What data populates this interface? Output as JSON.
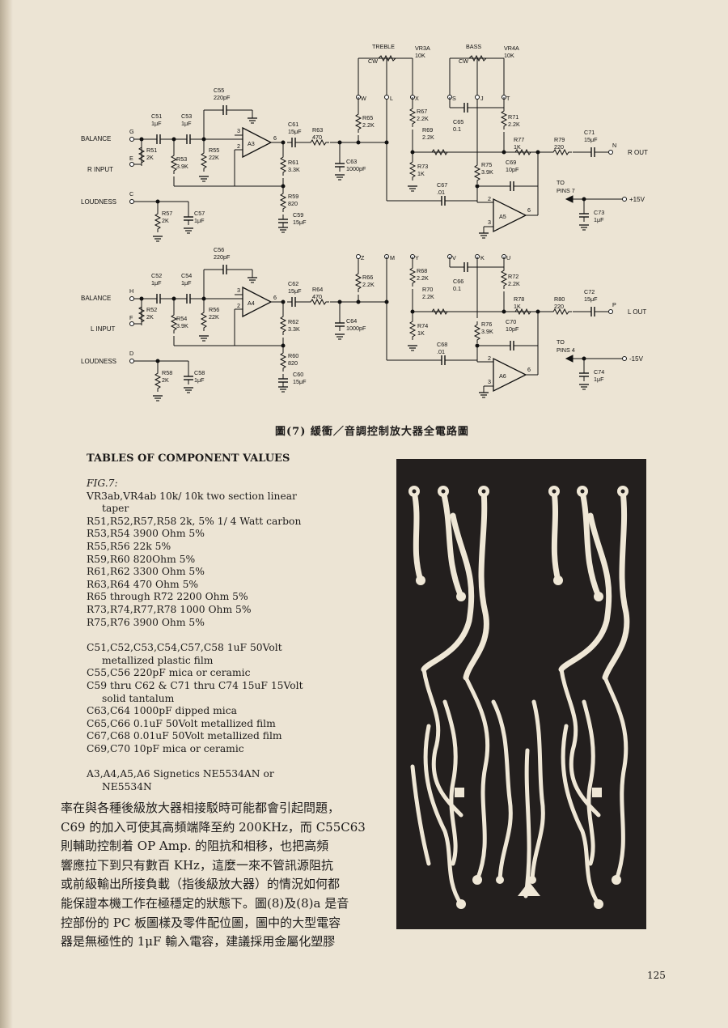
{
  "caption": "圖(7) 緩衝／音調控制放大器全電路圖",
  "table_title": "TABLES OF COMPONENT VALUES",
  "fig_label": "FIG.7:",
  "components": [
    {
      "text": "VR3ab,VR4ab  10k/ 10k two section linear",
      "indent": false
    },
    {
      "text": "taper",
      "indent": true
    },
    {
      "text": "R51,R52,R57,R58  2k, 5%  1/ 4 Watt carbon",
      "indent": false
    },
    {
      "text": "R53,R54  3900 Ohm 5%",
      "indent": false
    },
    {
      "text": "R55,R56  22k 5%",
      "indent": false
    },
    {
      "text": "R59,R60  820Ohm 5%",
      "indent": false
    },
    {
      "text": "R61,R62  3300 Ohm 5%",
      "indent": false
    },
    {
      "text": "R63,R64  470 Ohm 5%",
      "indent": false
    },
    {
      "text": "R65 through R72  2200 Ohm 5%",
      "indent": false
    },
    {
      "text": "R73,R74,R77,R78  1000 Ohm 5%",
      "indent": false
    },
    {
      "text": "R75,R76  3900 Ohm 5%",
      "indent": false
    },
    {
      "text": "",
      "gap": true
    },
    {
      "text": "C51,C52,C53,C54,C57,C58  1uF  50Volt",
      "indent": false
    },
    {
      "text": "metallized plastic film",
      "indent": true
    },
    {
      "text": "C55,C56  220pF mica or ceramic",
      "indent": false
    },
    {
      "text": "C59 thru C62 & C71 thru C74  15uF  15Volt",
      "indent": false
    },
    {
      "text": "solid tantalum",
      "indent": true
    },
    {
      "text": "C63,C64  1000pF dipped mica",
      "indent": false
    },
    {
      "text": "C65,C66  0.1uF 50Volt metallized film",
      "indent": false
    },
    {
      "text": "C67,C68  0.01uF 50Volt metallized film",
      "indent": false
    },
    {
      "text": "C69,C70  10pF mica or ceramic",
      "indent": false
    },
    {
      "text": "",
      "gap": true
    },
    {
      "text": "A3,A4,A5,A6  Signetics   NE5534AN   or",
      "indent": false
    },
    {
      "text": "NE5534N",
      "indent": true
    }
  ],
  "chinese_paragraph": [
    "率在與各種後級放大器相接駁時可能都會引起問題，",
    "C69 的加入可使其高頻端降至約 200KHz，而 C55C63",
    "則輔助控制着 OP Amp. 的阻抗和相移，也把高頻",
    "響應拉下到只有數百 KHz，這麼一來不管訊源阻抗",
    "或前級輸出所接負載（指後級放大器）的情況如何都",
    "能保證本機工作在極穩定的狀態下。圖(8)及(8)a 是音",
    "控部份的 PC 板圖樣及零件配位圖，圖中的大型電容",
    "器是無極性的 1μF 輸入電容，建議採用金屬化塑膠"
  ],
  "page_number": "125",
  "schematic": {
    "top": {
      "balance": "BALANCE",
      "input": "R INPUT",
      "loudness": "LOUDNESS",
      "output": "R OUT",
      "node_in": "G",
      "node_e": "E",
      "node_c": "C",
      "node_n": "N",
      "r51": "R51",
      "r51v": "2K",
      "r53": "R53",
      "r53v": "3.9K",
      "r55": "R55",
      "r55v": "22K",
      "c51": "C51",
      "c51v": "1μF",
      "c53": "C53",
      "c53v": "1μF",
      "c55": "C55",
      "c55v": "220pF",
      "opamp": "A3",
      "c61": "C61",
      "c61v": "15μF",
      "r63": "R63",
      "r63v": "470",
      "r61": "R61",
      "r61v": "3.3K",
      "r59": "R59",
      "r59v": "820",
      "c59": "C59",
      "c59v": "15μF",
      "c63": "C63",
      "c63v": "1000pF",
      "r57": "R57",
      "r57v": "2K",
      "c57": "C57",
      "c57v": "1μF",
      "treble": "TREBLE",
      "vr3a": "VR3A",
      "vr3av": "10K",
      "bass": "BASS",
      "vr4a": "VR4A",
      "vr4av": "10K",
      "cw": "CW",
      "w": "W",
      "l": "L",
      "x": "X",
      "s": "S",
      "j": "J",
      "tt": "T",
      "r65": "R65",
      "r65v": "2.2K",
      "r67": "R67",
      "r67v": "2.2K",
      "r69": "R69",
      "r69v": "2.2K",
      "c65": "C65",
      "c65v": "0.1",
      "r71": "R71",
      "r71v": "2.2K",
      "r73": "R73",
      "r73v": "1K",
      "r75": "R75",
      "r75v": "3.9K",
      "c69": "C69",
      "c69v": "10pF",
      "r77": "R77",
      "r77v": "1K",
      "r79": "R79",
      "r79v": "220",
      "c71": "C71",
      "c71v": "15μF",
      "c67": "C67",
      "c67v": ".01",
      "opamp2": "A5",
      "to_pins": "TO",
      "pins": "PINS 7",
      "supply": "+15V",
      "c73": "C73",
      "c73v": "1μF"
    },
    "bottom": {
      "balance": "BALANCE",
      "input": "L INPUT",
      "loudness": "LOUDNESS",
      "output": "L OUT",
      "node_in": "H",
      "node_e": "F",
      "node_c": "D",
      "node_n": "P",
      "r51": "R52",
      "r51v": "2K",
      "r53": "R54",
      "r53v": "3.9K",
      "r55": "R56",
      "r55v": "22K",
      "c51": "C52",
      "c51v": "1μF",
      "c53": "C54",
      "c53v": "1μF",
      "c55": "C56",
      "c55v": "220pF",
      "opamp": "A4",
      "c61": "C62",
      "c61v": "15μF",
      "r63": "R64",
      "r63v": "470",
      "r61": "R62",
      "r61v": "3.3K",
      "r59": "R60",
      "r59v": "820",
      "c59": "C60",
      "c59v": "15μF",
      "c63": "C64",
      "c63v": "1000pF",
      "r57": "R58",
      "r57v": "2K",
      "c57": "C58",
      "c57v": "1μF",
      "w": "Z",
      "l": "M",
      "x": "Y",
      "s": "V",
      "j": "K",
      "tt": "U",
      "r65": "R66",
      "r65v": "2.2K",
      "r67": "R68",
      "r67v": "2.2K",
      "r69": "R70",
      "r69v": "2.2K",
      "c65": "C66",
      "c65v": "0.1",
      "r71": "R72",
      "r71v": "2.2K",
      "r73": "R74",
      "r73v": "1K",
      "r75": "R76",
      "r75v": "3.9K",
      "c69": "C70",
      "c69v": "10pF",
      "r77": "R78",
      "r77v": "1K",
      "r79": "R80",
      "r79v": "220",
      "c71": "C72",
      "c71v": "15μF",
      "c67": "C68",
      "c67v": ".01",
      "opamp2": "A6",
      "to_pins": "TO",
      "pins": "PINS 4",
      "supply": "-15V",
      "c73": "C74",
      "c73v": "1μF"
    },
    "pin_labels": {
      "p2": "2",
      "p3": "3",
      "p6": "6"
    }
  }
}
